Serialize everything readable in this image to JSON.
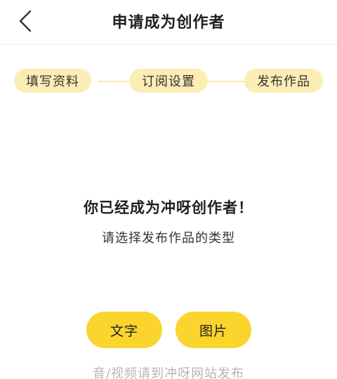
{
  "header": {
    "back_icon": "chevron-left-icon",
    "title": "申请成为创作者"
  },
  "steps": [
    {
      "label": "填写资料"
    },
    {
      "label": "订阅设置"
    },
    {
      "label": "发布作品"
    }
  ],
  "main": {
    "success_title": "你已经成为冲呀创作者！",
    "success_subtitle": "请选择发布作品的类型"
  },
  "actions": {
    "text_label": "文字",
    "image_label": "图片"
  },
  "footer": {
    "note": "音/视频请到冲呀网站发布"
  },
  "colors": {
    "accent": "#fbd42d",
    "step_bg": "#fcedb5",
    "step_line": "#fde9a8",
    "muted_text": "#b5b5b5"
  }
}
